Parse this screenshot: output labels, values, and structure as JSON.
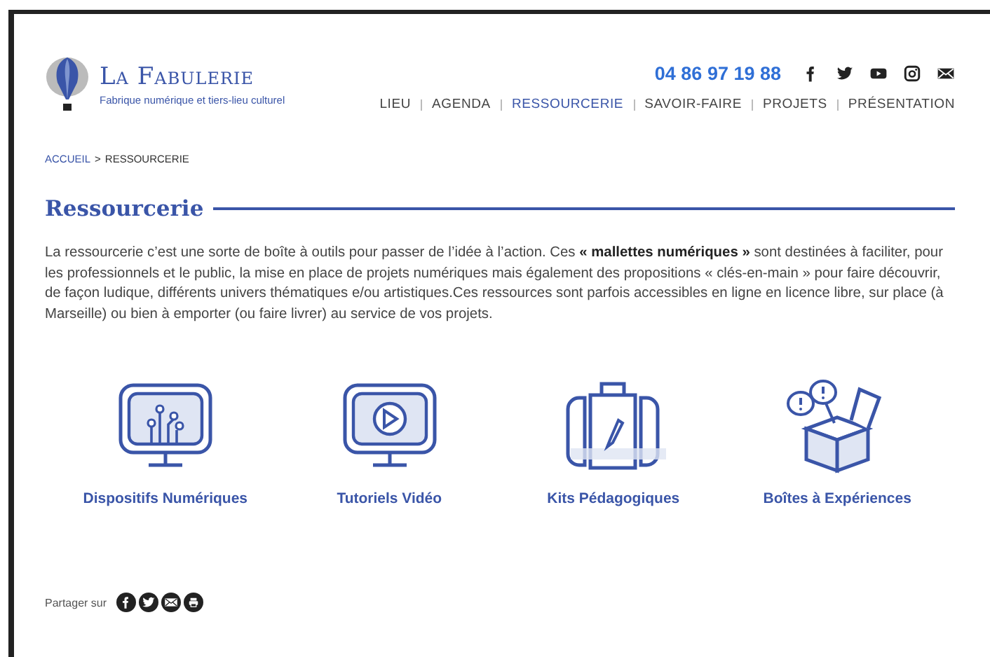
{
  "brand": {
    "name": "La Fabulerie",
    "tagline": "Fabrique numérique et tiers-lieu culturel"
  },
  "header": {
    "phone": "04 86 97 19 88"
  },
  "nav": [
    {
      "label": "LIEU",
      "selected": false
    },
    {
      "label": "AGENDA",
      "selected": false
    },
    {
      "label": "RESSOURCERIE",
      "selected": true
    },
    {
      "label": "SAVOIR-FAIRE",
      "selected": false
    },
    {
      "label": "PROJETS",
      "selected": false
    },
    {
      "label": "PRÉSENTATION",
      "selected": false
    }
  ],
  "breadcrumb": {
    "links": [
      "ACCUEIL"
    ],
    "separator": ">",
    "current": "RESSOURCERIE"
  },
  "title": "Ressourcerie",
  "intro": "La ressourcerie c’est une sorte de boîte à outils pour passer de l’idée à l’action. Ces **« mallettes numériques »** sont destinées à faciliter, pour les professionnels et le public, la mise en place de projets numériques mais également des propositions « clés-en-main » pour faire découvrir, de façon ludique, différents univers thématiques e/ou artistiques.Ces ressources sont parfois accessibles en ligne en licence libre, sur place (à Marseille) ou bien à emporter (ou faire livrer) au service de vos projets.",
  "categories": [
    {
      "kind": "circuit",
      "label": "Dispositifs Numériques"
    },
    {
      "kind": "video",
      "label": "Tutoriels Vidéo"
    },
    {
      "kind": "suitcase",
      "label": "Kits Pédagogiques"
    },
    {
      "kind": "box",
      "label": "Boîtes à Expériences"
    }
  ],
  "share": {
    "label": "Partager sur"
  }
}
